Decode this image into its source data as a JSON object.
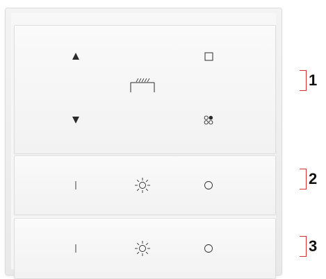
{
  "panel": {
    "keys": [
      {
        "id": "1",
        "symbols": [
          "triangle-up-icon",
          "stop-square-icon",
          "blind-icon",
          "triangle-down-icon",
          "scene-dots-icon"
        ]
      },
      {
        "id": "2",
        "symbols": [
          "on-line-icon",
          "sun-dimmer-icon",
          "off-circle-icon"
        ]
      },
      {
        "id": "3",
        "symbols": [
          "on-line-icon",
          "sun-dimmer-icon",
          "off-circle-icon"
        ]
      }
    ]
  },
  "callouts": {
    "one": "1",
    "two": "2",
    "three": "3"
  },
  "colors": {
    "callout_bracket": "#d9302c",
    "symbol": "#2b2b2b",
    "key_face": "#f6f6f6"
  }
}
